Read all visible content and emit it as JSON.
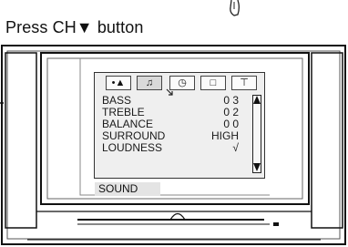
{
  "instruction": "Press CH▼ button",
  "osd": {
    "tabs": [
      {
        "icon": "picture-icon",
        "glyph": "•▲"
      },
      {
        "icon": "sound-icon",
        "glyph": "♫"
      },
      {
        "icon": "clock-icon",
        "glyph": "◷"
      },
      {
        "icon": "screen-icon",
        "glyph": "□"
      },
      {
        "icon": "antenna-icon",
        "glyph": "⊤"
      }
    ],
    "active_tab": 1,
    "items": [
      {
        "label": "BASS",
        "value": "0 3"
      },
      {
        "label": "TREBLE",
        "value": "0 2"
      },
      {
        "label": "BALANCE",
        "value": "0 0"
      },
      {
        "label": "SURROUND",
        "value": "HIGH"
      },
      {
        "label": "LOUDNESS",
        "value": "√"
      }
    ],
    "menu_title": "SOUND"
  }
}
